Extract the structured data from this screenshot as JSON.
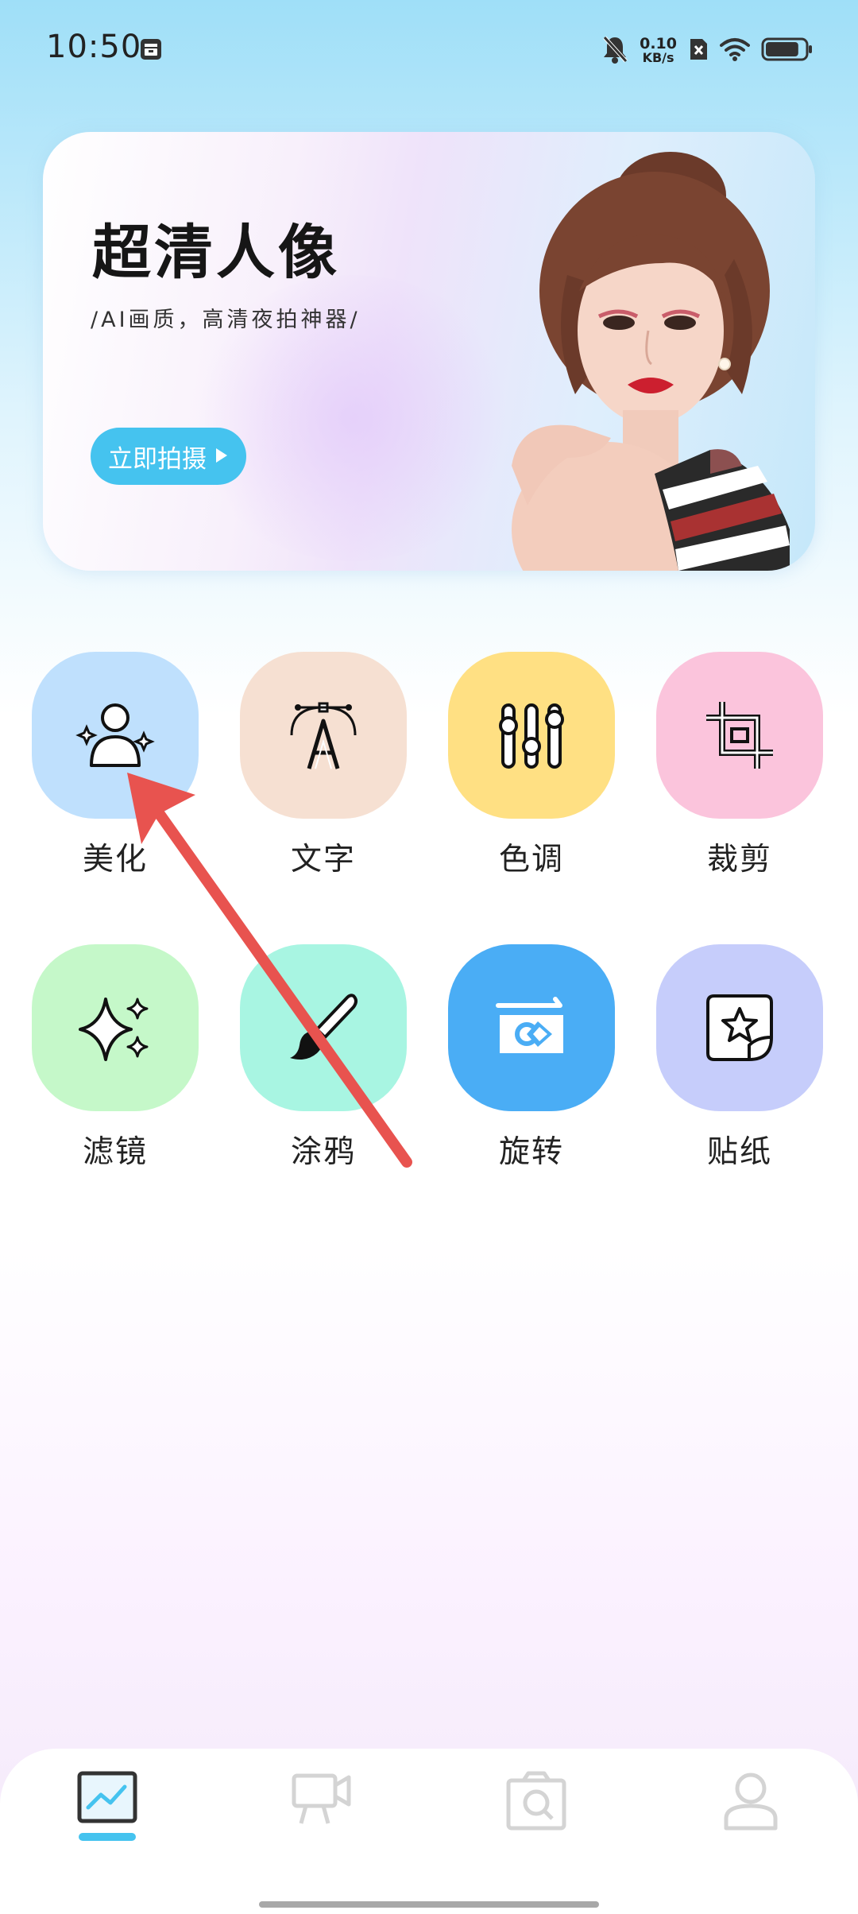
{
  "status_bar": {
    "time": "10:50",
    "net_speed_value": "0.10",
    "net_speed_unit": "KB/s",
    "battery_level": 0.85
  },
  "banner": {
    "title": "超清人像",
    "subtitle": "/AI画质，高清夜拍神器/",
    "button_label": "立即拍摄"
  },
  "features": [
    {
      "label": "美化",
      "icon": "beauty-person-sparkle-icon",
      "color": "#bfe0fd"
    },
    {
      "label": "文字",
      "icon": "text-pen-tool-icon",
      "color": "#f6e0d2"
    },
    {
      "label": "色调",
      "icon": "tone-sliders-icon",
      "color": "#ffe083"
    },
    {
      "label": "裁剪",
      "icon": "crop-icon",
      "color": "#fbc4dc"
    },
    {
      "label": "滤镜",
      "icon": "filter-sparkle-icon",
      "color": "#c5f8c9"
    },
    {
      "label": "涂鸦",
      "icon": "doodle-brush-icon",
      "color": "#a8f5e2"
    },
    {
      "label": "旋转",
      "icon": "rotate-icon",
      "color": "#4aadf5"
    },
    {
      "label": "贴纸",
      "icon": "sticker-star-icon",
      "color": "#c6cdfb"
    }
  ],
  "bottom_nav": {
    "items": [
      {
        "icon": "gallery-chart-icon",
        "active": true
      },
      {
        "icon": "video-camera-icon",
        "active": false
      },
      {
        "icon": "camera-icon",
        "active": false
      },
      {
        "icon": "profile-icon",
        "active": false
      }
    ],
    "accent_color": "#45c3ef"
  },
  "annotation": {
    "arrow_color": "#e8534f"
  }
}
